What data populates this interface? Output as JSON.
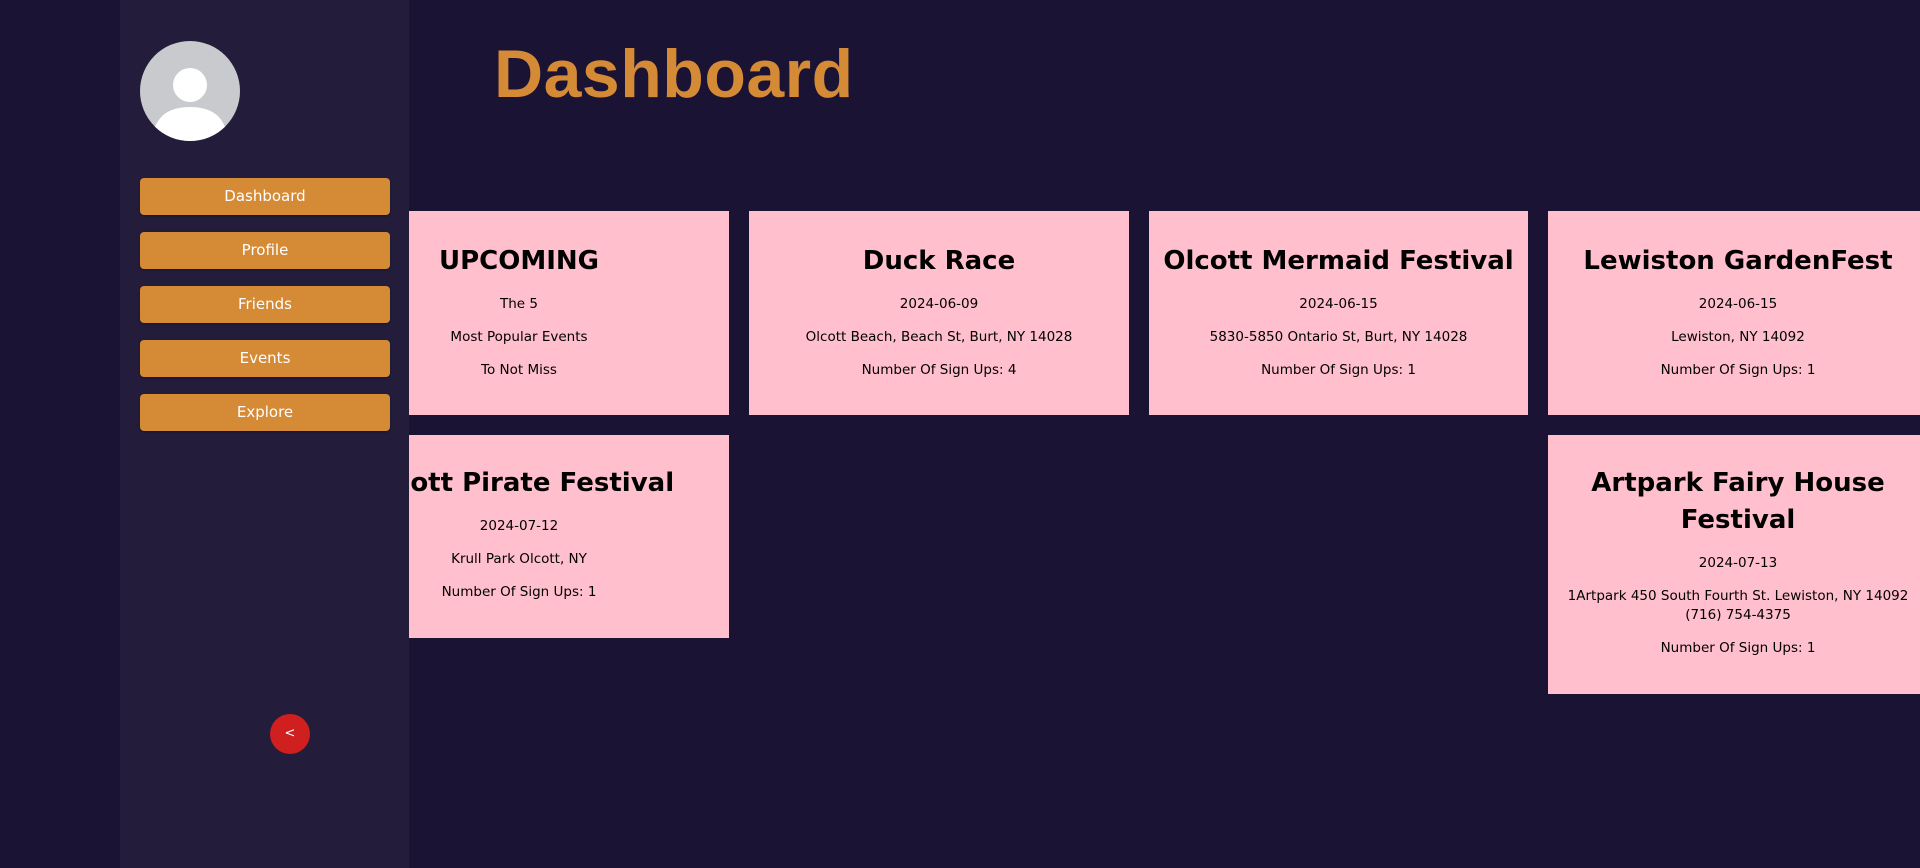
{
  "sidebar": {
    "nav": [
      {
        "label": "Dashboard"
      },
      {
        "label": "Profile"
      },
      {
        "label": "Friends"
      },
      {
        "label": "Events"
      },
      {
        "label": "Explore"
      }
    ],
    "collapse_label": "<"
  },
  "header": {
    "title": "Dashboard"
  },
  "upcoming_card": {
    "title": "UPCOMING",
    "line1": "The 5",
    "line2": "Most Popular Events",
    "line3": "To Not Miss"
  },
  "events": [
    {
      "title": "Duck Race",
      "date": "2024-06-09",
      "address": "Olcott Beach, Beach St, Burt, NY 14028",
      "signups": "Number Of Sign Ups: 4"
    },
    {
      "title": "Olcott Mermaid Festival",
      "date": "2024-06-15",
      "address": "5830-5850 Ontario St, Burt, NY 14028",
      "signups": "Number Of Sign Ups: 1"
    },
    {
      "title": "Lewiston GardenFest",
      "date": "2024-06-15",
      "address": "Lewiston, NY 14092",
      "signups": "Number Of Sign Ups: 1"
    },
    {
      "title": "Olcott Pirate Festival",
      "date": "2024-07-12",
      "address": "Krull Park Olcott, NY",
      "signups": "Number Of Sign Ups: 1"
    },
    {
      "title": "Artpark Fairy House Festival",
      "date": "2024-07-13",
      "address": "1Artpark 450 South Fourth St. Lewiston, NY 14092 (716) 754-4375",
      "signups": "Number Of Sign Ups: 1"
    }
  ],
  "colors": {
    "background": "#1b1333",
    "sidebar": "#231d3b",
    "accent": "#d58a36",
    "card": "#ffbfcc",
    "collapse_button": "#cf1f1f"
  }
}
